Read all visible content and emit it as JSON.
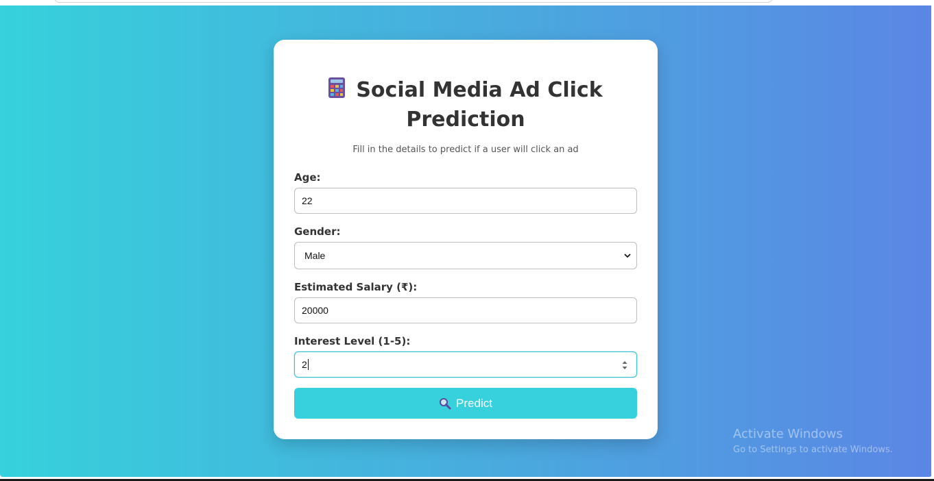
{
  "app": {
    "title": "Social Media Ad Click Prediction",
    "subtitle": "Fill in the details to predict if a user will click an ad",
    "title_icon": "calculator-icon"
  },
  "form": {
    "age": {
      "label": "Age:",
      "value": "22"
    },
    "gender": {
      "label": "Gender:",
      "selected": "Male",
      "icon": "chevron-down-icon"
    },
    "salary": {
      "label": "Estimated Salary (₹):",
      "value": "20000"
    },
    "interest": {
      "label": "Interest Level (1-5):",
      "value": "2",
      "icon": "spinner-arrows-icon"
    }
  },
  "predict_button": {
    "label": "Predict",
    "icon": "magnifier-icon"
  },
  "watermark": {
    "title": "Activate Windows",
    "subtitle": "Go to Settings to activate Windows."
  },
  "colors": {
    "gradient_start": "#36d1dc",
    "gradient_end": "#5b86e5",
    "button": "#36d1dc",
    "card": "#ffffff",
    "text": "#333333"
  }
}
